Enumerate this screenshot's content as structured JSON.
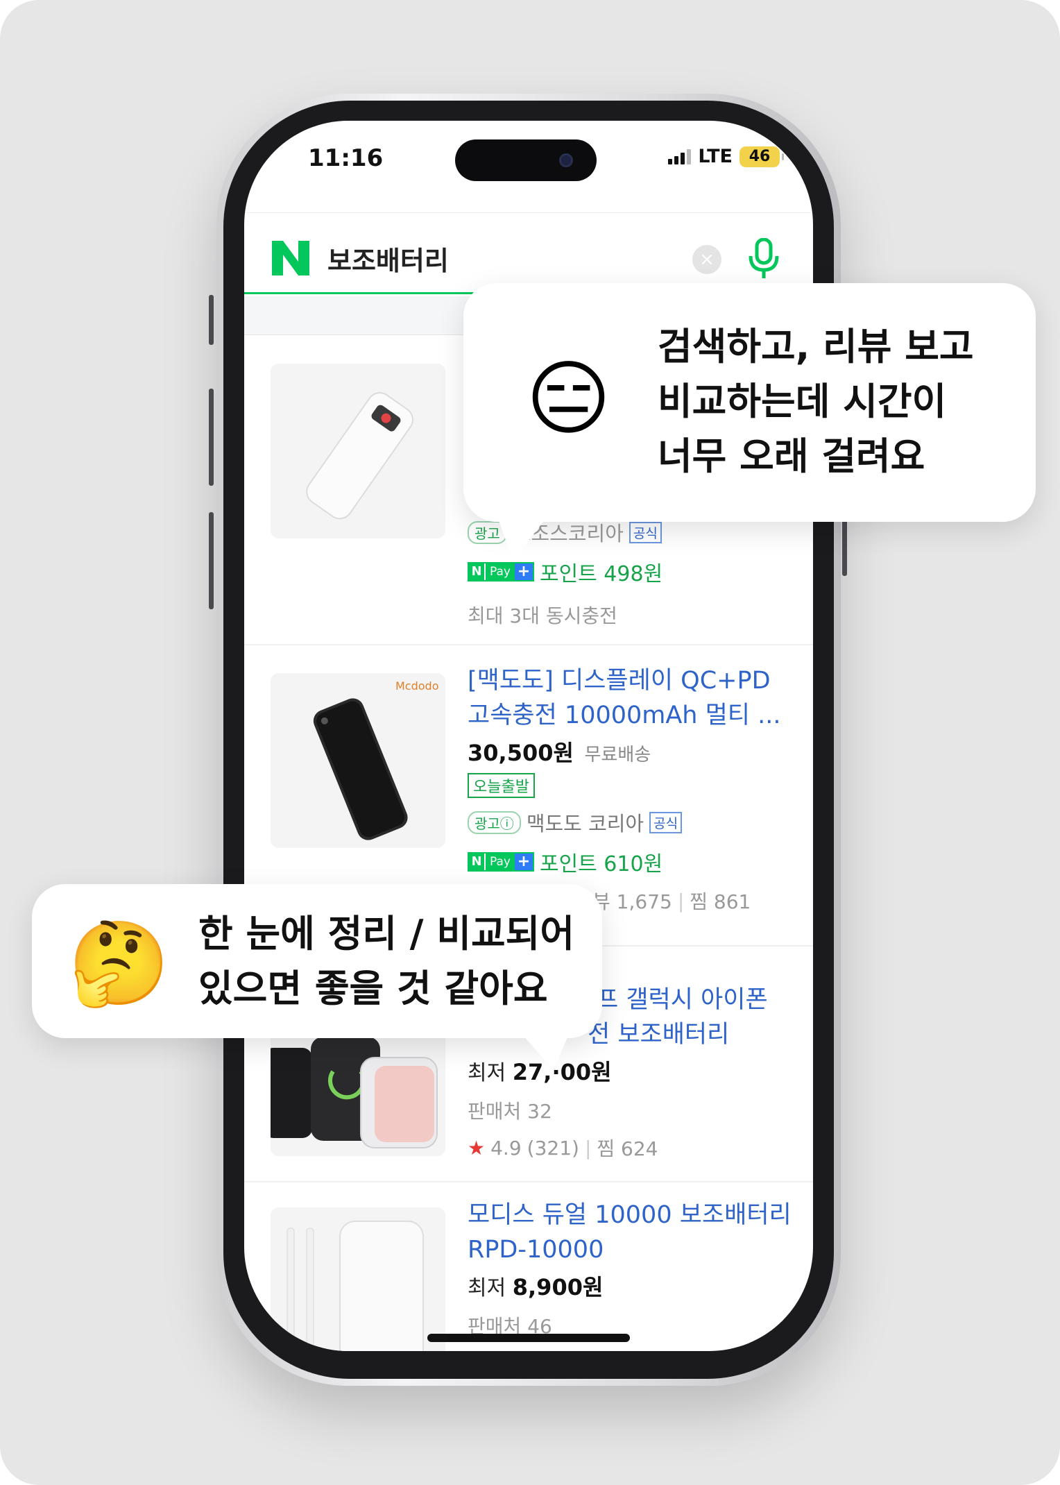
{
  "status_bar": {
    "time": "11:16",
    "network": "LTE",
    "battery": "46"
  },
  "search": {
    "query": "보조배터리",
    "clear_icon": "×"
  },
  "products": [
    {
      "seller": "보조스코리아",
      "official": "공식",
      "ad": "광고",
      "npay": {
        "n": "N",
        "pay": "Pay",
        "plus": "+"
      },
      "points": "포인트 498원",
      "feature": "최대 3대 동시충전"
    },
    {
      "brand_logo": "Mcdodo",
      "title_line1": "[맥도도] 디스플레이 QC+PD",
      "title_line2": "고속충전 10000mAh 멀티 ...",
      "price": "30,500원",
      "shipping": "무료배송",
      "today_badge": "오늘출발",
      "ad": "광고ⓘ",
      "seller": "맥도도 코리아",
      "official": "공식",
      "npay": {
        "n": "N",
        "pay": "Pay",
        "plus": "+"
      },
      "points": "포인트 610원",
      "reviews": "뷰 1,675",
      "wishes": "찜 861"
    },
    {
      "title_line1": "프 갤럭시 아이폰",
      "title_line2": "전 보조배터리",
      "price_prefix": "최저",
      "price": "27,·00원",
      "sellers": "판매처 32",
      "rating": "4.9",
      "rating_count": "(321)",
      "wishes": "찜 624"
    },
    {
      "title_line1": "모디스 듀얼 10000 보조배터리",
      "title_line2": "RPD-10000",
      "price_prefix": "최저",
      "price": "8,900원",
      "sellers": "판매처 46"
    }
  ],
  "bubbles": [
    {
      "emoji": "😑",
      "text": "검색하고, 리뷰 보고\n비교하는데 시간이\n너무 오래 걸려요"
    },
    {
      "emoji": "🤔",
      "text": "한 눈에 정리 / 비교되어\n있으면 좋을 것 같아요"
    }
  ],
  "colors": {
    "naver_green": "#03c75a",
    "link_blue": "#2e63c9",
    "background": "#e6e6e7"
  }
}
